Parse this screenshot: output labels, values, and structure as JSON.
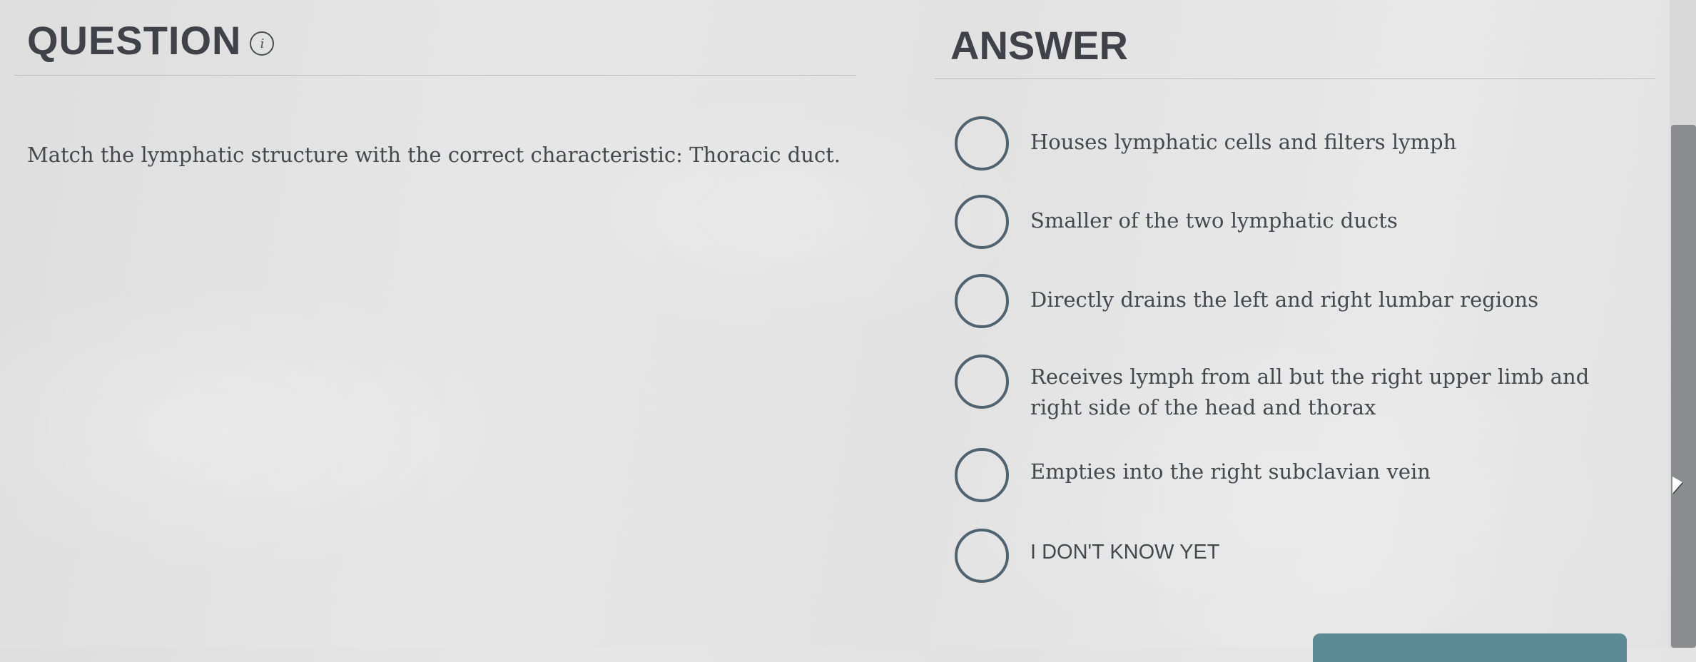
{
  "question": {
    "title": "QUESTION",
    "info_icon_glyph": "i",
    "text": "Match the lymphatic structure with the correct characteristic: Thoracic duct."
  },
  "answer": {
    "title": "ANSWER",
    "options": [
      {
        "label": "Houses lymphatic cells and filters lymph",
        "selected": false
      },
      {
        "label": "Smaller of the two lymphatic ducts",
        "selected": false
      },
      {
        "label": "Directly drains the left and right lumbar regions",
        "selected": false
      },
      {
        "label": "Receives lymph from all but the right upper limb and right side of the head and thorax",
        "selected": false
      },
      {
        "label": "Empties into the right subclavian vein",
        "selected": false
      },
      {
        "label": "I DON'T KNOW YET",
        "selected": false
      }
    ]
  },
  "colors": {
    "radio_border": "#4f6470",
    "text": "#45484d",
    "submit_button": "#5b8a94",
    "scrollbar_thumb": "#8a8c8f"
  },
  "icons": {
    "info": "info-icon",
    "cursor": "mouse-pointer-icon"
  }
}
